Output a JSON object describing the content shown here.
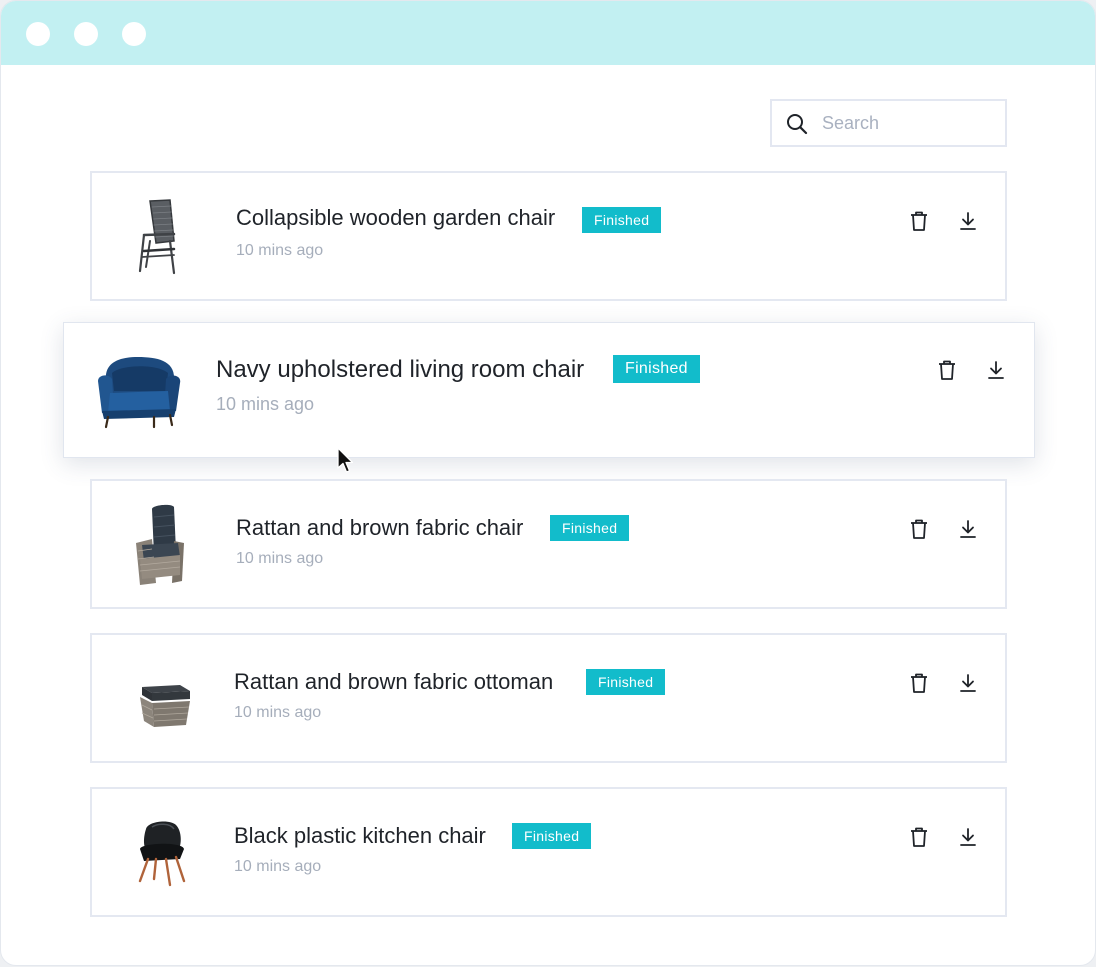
{
  "search": {
    "placeholder": "Search",
    "icon": "search-icon"
  },
  "items": [
    {
      "title": "Collapsible wooden garden chair",
      "status": "Finished",
      "time": "10 mins ago",
      "thumbnail": "folding-garden-chair"
    },
    {
      "title": "Navy upholstered living room chair",
      "status": "Finished",
      "time": "10 mins ago",
      "thumbnail": "navy-armchair"
    },
    {
      "title": "Rattan and brown fabric chair",
      "status": "Finished",
      "time": "10 mins ago",
      "thumbnail": "rattan-reclining-chair"
    },
    {
      "title": "Rattan and brown fabric ottoman",
      "status": "Finished",
      "time": "10 mins ago",
      "thumbnail": "rattan-ottoman"
    },
    {
      "title": "Black plastic kitchen chair",
      "status": "Finished",
      "time": "10 mins ago",
      "thumbnail": "black-shell-chair"
    }
  ],
  "colors": {
    "titlebar": "#c2f0f2",
    "badge": "#12bccb",
    "muted_text": "#a6aebb",
    "border": "#e4e8f1"
  }
}
